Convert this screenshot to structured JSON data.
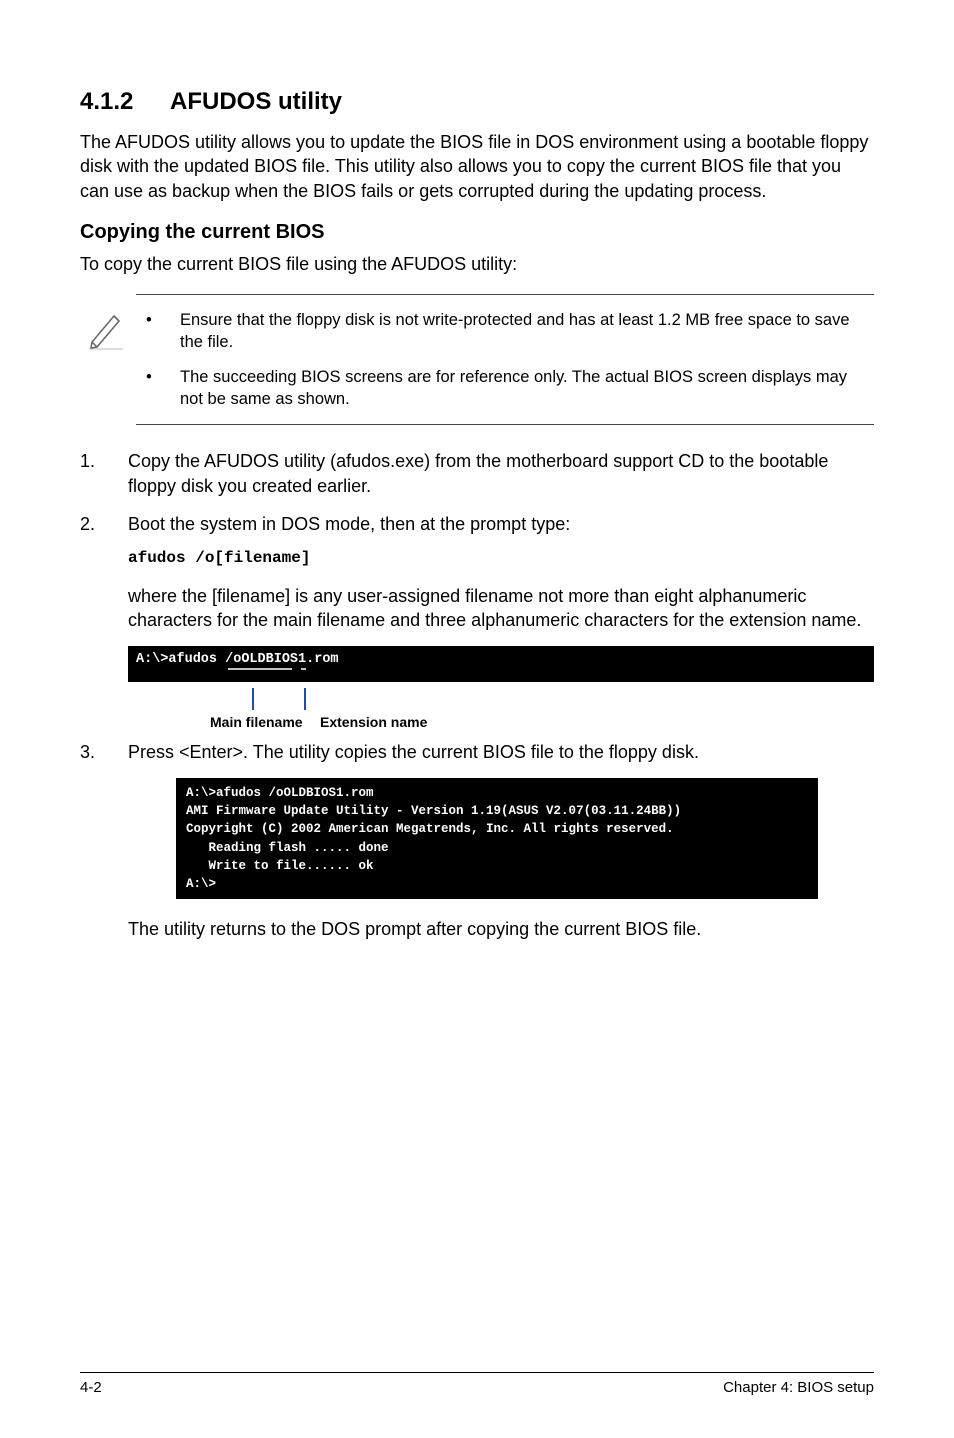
{
  "heading": {
    "number": "4.1.2",
    "title": "AFUDOS utility"
  },
  "intro_para": "The AFUDOS utility allows you to update the BIOS file in DOS environment using a bootable floppy disk with the updated BIOS file. This utility also allows you to copy the current BIOS file that you can use as backup when the BIOS fails or gets corrupted during the updating process.",
  "subheading": "Copying the current BIOS",
  "sub_intro": "To copy the current BIOS file using the AFUDOS utility:",
  "notes": [
    "Ensure that the floppy disk is not write-protected and has at least 1.2 MB free space to save the file.",
    "The succeeding BIOS screens are for reference only. The actual BIOS screen displays may not be same as shown."
  ],
  "steps": [
    {
      "num": "1.",
      "text": "Copy the AFUDOS utility (afudos.exe) from the motherboard support CD to the bootable floppy disk you created earlier."
    },
    {
      "num": "2.",
      "text": "Boot the system in DOS mode, then at the prompt type:",
      "code": "afudos /o[filename]",
      "after": "where the [filename] is any user-assigned filename not more than eight alphanumeric characters  for the main filename and three alphanumeric characters for the extension name."
    },
    {
      "num": "3.",
      "text": "Press <Enter>. The utility copies the current BIOS file to the floppy disk."
    }
  ],
  "terminal1": "A:\\>afudos /oOLDBIOS1.rom",
  "anno": {
    "main": "Main filename",
    "ext": "Extension name"
  },
  "terminal2_lines": [
    "A:\\>afudos /oOLDBIOS1.rom",
    "AMI Firmware Update Utility - Version 1.19(ASUS V2.07(03.11.24BB))",
    "Copyright (C) 2002 American Megatrends, Inc. All rights reserved.",
    "   Reading flash ..... done",
    "   Write to file...... ok",
    "A:\\>"
  ],
  "closing": "The utility returns to the DOS prompt after copying the current BIOS file.",
  "footer": {
    "left": "4-2",
    "right": "Chapter 4: BIOS setup"
  }
}
